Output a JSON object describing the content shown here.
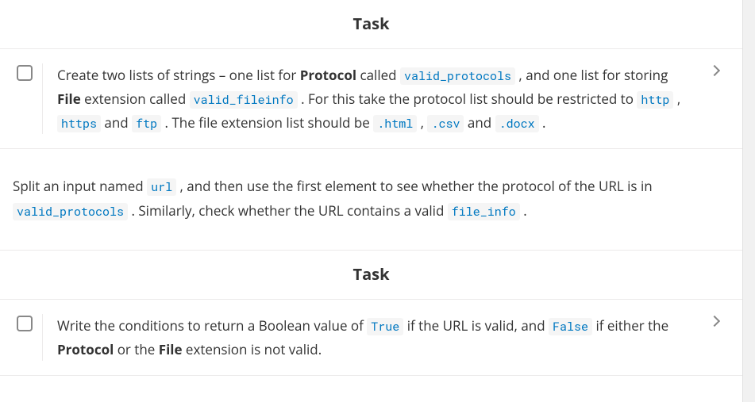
{
  "section1": {
    "heading": "Task",
    "task": {
      "frag_1": "Create two lists of strings – one list for ",
      "bold_1": "Protocol",
      "frag_2": " called ",
      "code_1": "valid_protocols",
      "frag_3": " , and one list for storing ",
      "bold_2": "File",
      "frag_4": " extension called ",
      "code_2": "valid_fileinfo",
      "frag_5": " . For this take the protocol list should be restricted to ",
      "code_3": "http",
      "frag_6": " , ",
      "code_4": "https",
      "frag_7": " and ",
      "code_5": "ftp",
      "frag_8": " . The file extension list should be ",
      "code_6": ".html",
      "frag_9": " , ",
      "code_7": ".csv",
      "frag_10": " and ",
      "code_8": ".docx",
      "frag_11": " ."
    }
  },
  "paragraph": {
    "frag_1": "Split an input named ",
    "code_1": "url",
    "frag_2": " , and then use the first element to see whether the protocol of the URL is in ",
    "code_2": "valid_protocols",
    "frag_3": " . Similarly, check whether the URL contains a valid ",
    "code_3": "file_info",
    "frag_4": " ."
  },
  "section2": {
    "heading": "Task",
    "task": {
      "frag_1": "Write the conditions to return a Boolean value of ",
      "code_1": "True",
      "frag_2": " if the URL is valid, and ",
      "code_2": "False",
      "frag_3": " if either the ",
      "bold_1": "Protocol",
      "frag_4": " or the ",
      "bold_2": "File",
      "frag_5": " extension is not valid."
    }
  }
}
